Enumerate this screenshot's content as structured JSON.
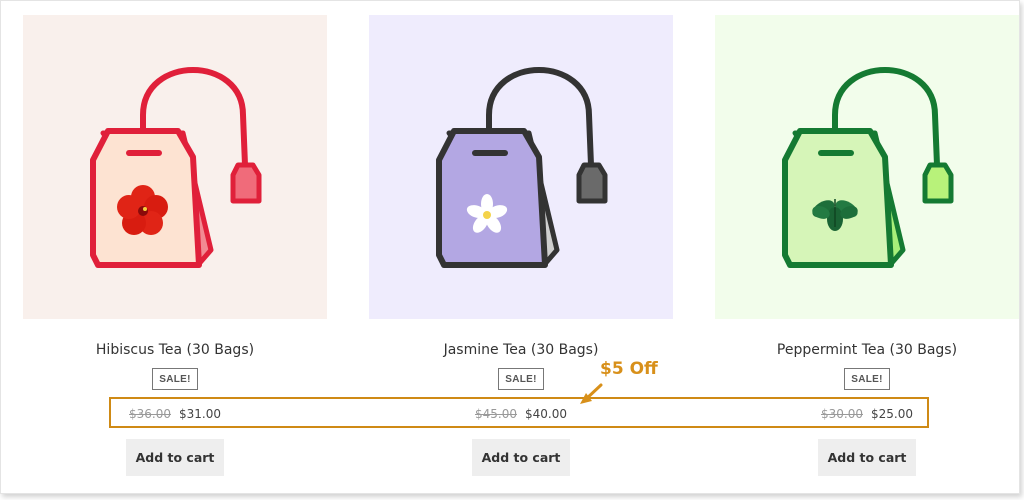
{
  "products": [
    {
      "name": "Hibiscus Tea (30 Bags)",
      "badge": "SALE!",
      "old_price": "$36.00",
      "new_price": "$31.00",
      "cta": "Add to cart",
      "bg_color": "#f9f0ec",
      "icon": "hibiscus-tea-bag-icon"
    },
    {
      "name": "Jasmine Tea (30 Bags)",
      "badge": "SALE!",
      "old_price": "$45.00",
      "new_price": "$40.00",
      "cta": "Add to cart",
      "bg_color": "#efecfd",
      "icon": "jasmine-tea-bag-icon"
    },
    {
      "name": "Peppermint Tea (30 Bags)",
      "badge": "SALE!",
      "old_price": "$30.00",
      "new_price": "$25.00",
      "cta": "Add to cart",
      "bg_color": "#f2fdeb",
      "icon": "peppermint-tea-bag-icon"
    }
  ],
  "annotation": {
    "label": "$5 Off",
    "color": "#d8901a",
    "icon": "arrow-icon"
  }
}
